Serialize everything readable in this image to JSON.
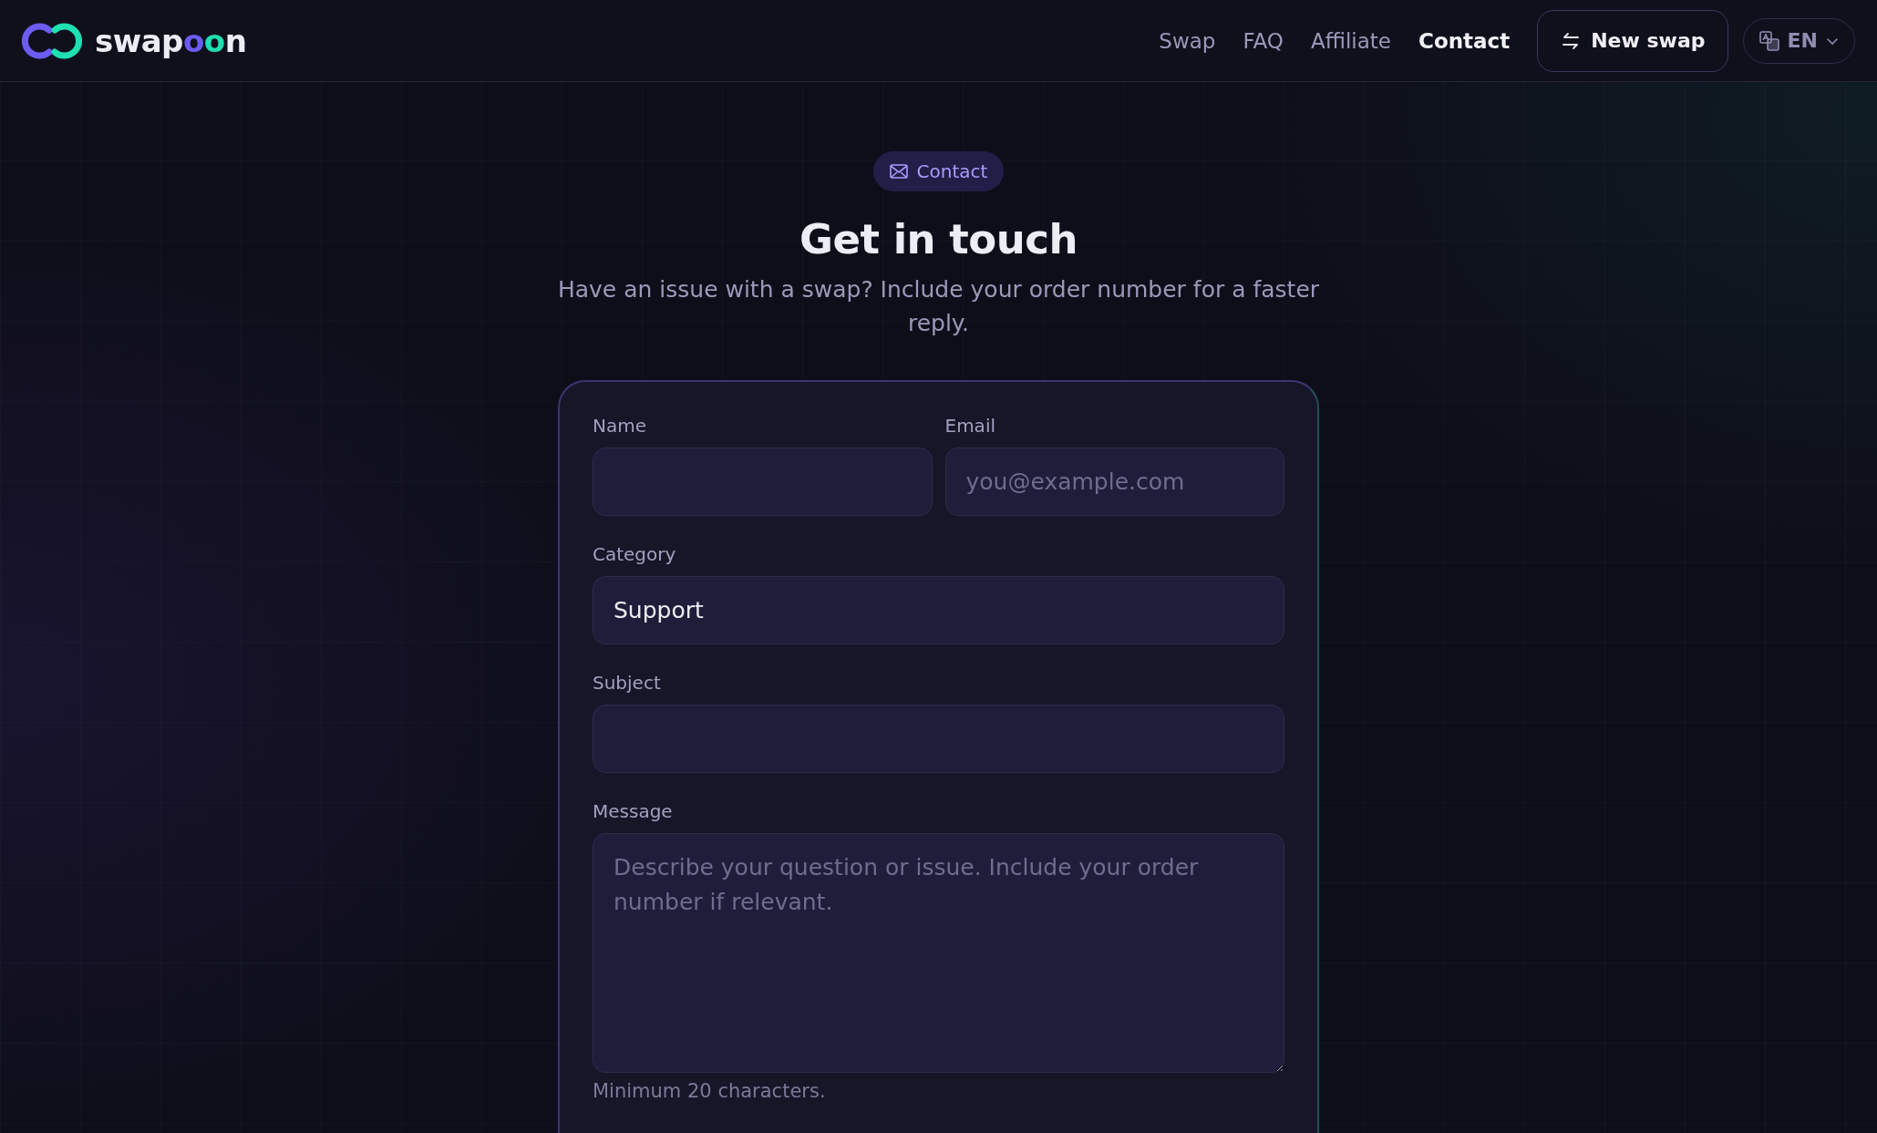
{
  "header": {
    "logo": {
      "parts": [
        {
          "text": "swap",
          "color": "#ececf4"
        },
        {
          "text": "o",
          "color": "#6c5cf2"
        },
        {
          "text": "o",
          "color": "#1fe0b2"
        },
        {
          "text": "n",
          "color": "#ececf4"
        }
      ]
    },
    "nav": [
      {
        "label": "Swap",
        "selected": false
      },
      {
        "label": "FAQ",
        "selected": false
      },
      {
        "label": "Affiliate",
        "selected": false
      },
      {
        "label": "Contact",
        "selected": true
      }
    ],
    "new_swap_button": "New swap",
    "language": "EN"
  },
  "hero": {
    "badge": "Contact",
    "title": "Get in touch",
    "subtitle": "Have an issue with a swap? Include your order number for a faster reply."
  },
  "form": {
    "rows": [
      {
        "fields": [
          {
            "kind": "input",
            "label": "Name"
          },
          {
            "kind": "input",
            "label": "Email",
            "placeholder": "you@example.com"
          }
        ]
      },
      {
        "fields": [
          {
            "kind": "select",
            "label": "Category",
            "value": "Support"
          }
        ]
      },
      {
        "fields": [
          {
            "kind": "input",
            "label": "Subject"
          }
        ]
      },
      {
        "fields": [
          {
            "kind": "textarea",
            "label": "Message",
            "placeholder": "Describe your question or issue. Include your order number if relevant.",
            "hint": "Minimum 20 characters."
          }
        ]
      }
    ]
  }
}
